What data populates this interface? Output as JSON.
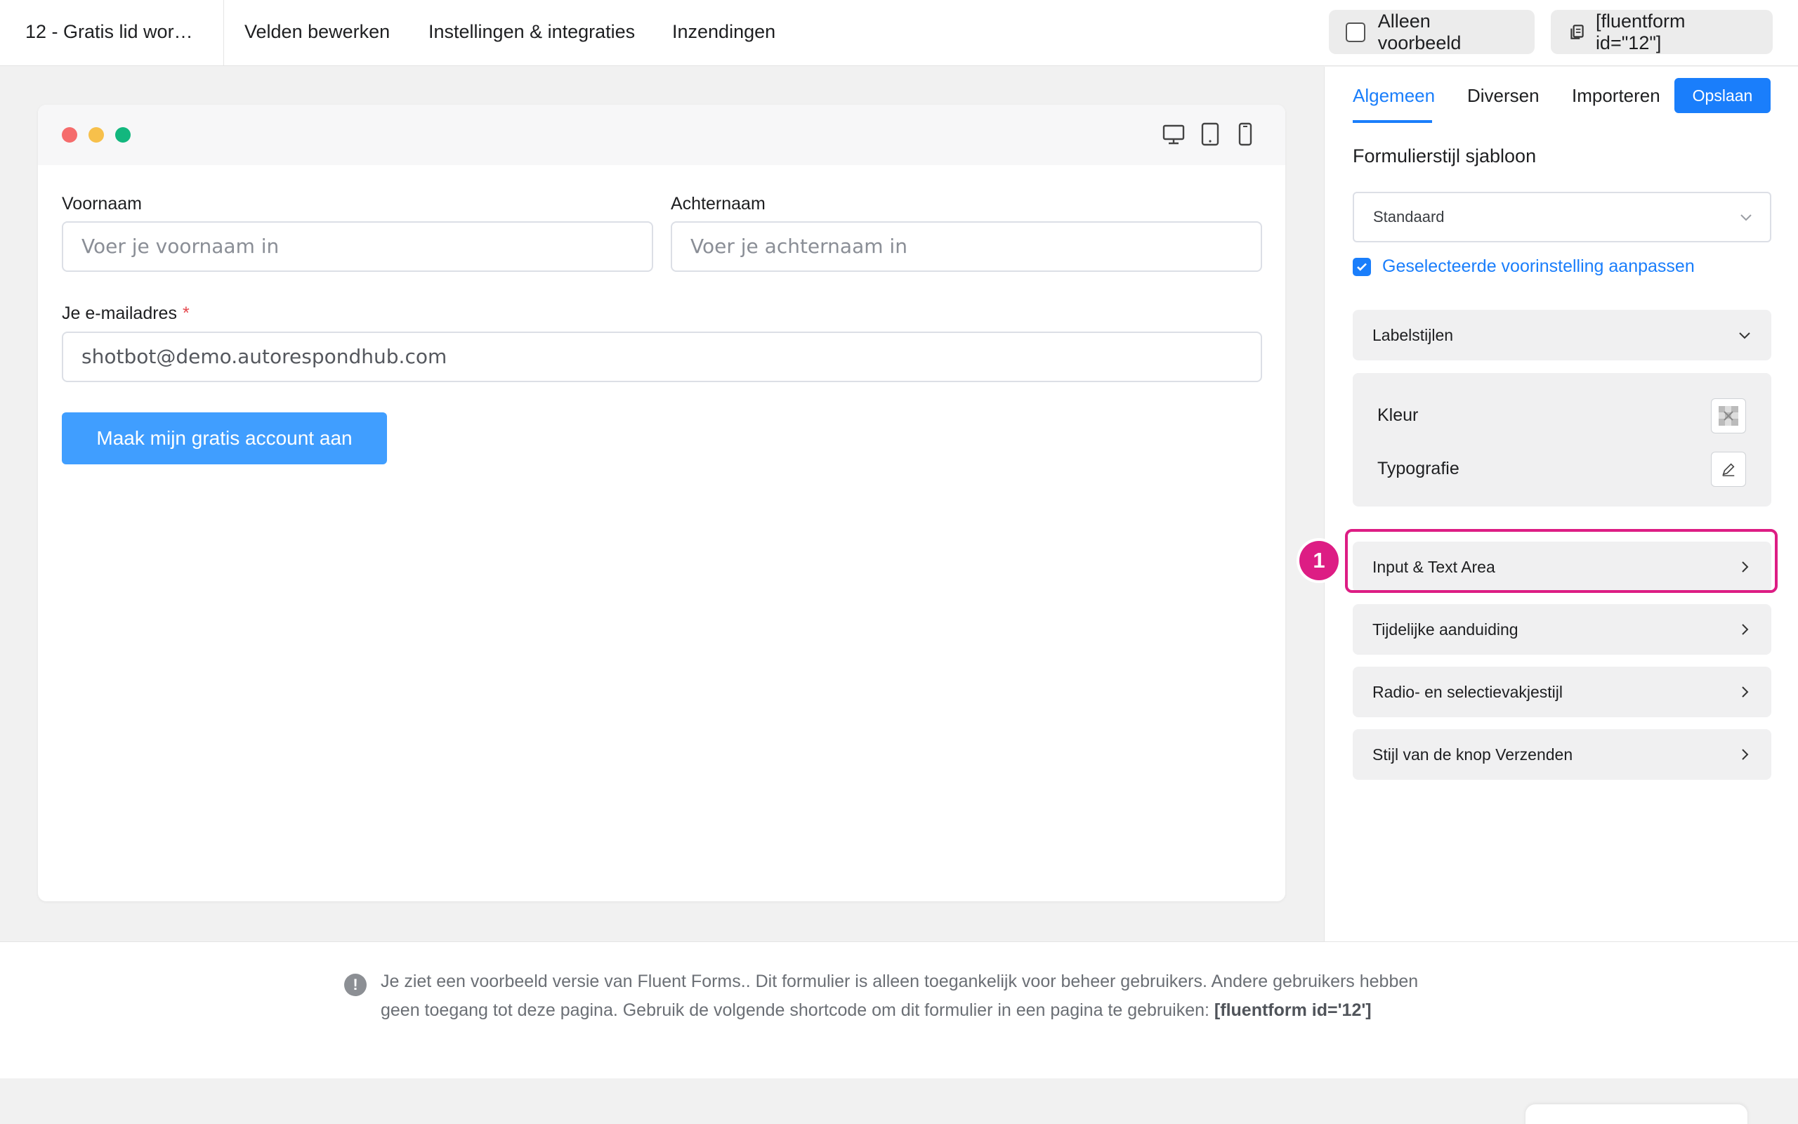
{
  "header": {
    "form_title": "12 - Gratis lid wor…",
    "nav": [
      "Velden bewerken",
      "Instellingen & integraties",
      "Inzendingen"
    ],
    "preview_only_label": "Alleen voorbeeld",
    "shortcode_label": "[fluentform id=\"12\"]"
  },
  "form": {
    "first_name_label": "Voornaam",
    "first_name_placeholder": "Voer je voornaam in",
    "last_name_label": "Achternaam",
    "last_name_placeholder": "Voer je achternaam in",
    "email_label": "Je e-mailadres",
    "email_required_mark": "*",
    "email_value": "shotbot@demo.autorespondhub.com",
    "submit_label": " Maak mijn gratis account aan"
  },
  "panel": {
    "tabs": [
      "Algemeen",
      "Diversen",
      "Importeren"
    ],
    "save_label": "Opslaan",
    "template_title": "Formulierstijl sjabloon",
    "template_value": "Standaard",
    "customize_label": "Geselecteerde voorinstelling aanpassen",
    "label_styles": "Labelstijlen",
    "color_label": "Kleur",
    "typography_label": "Typografie",
    "sections": [
      "Input & Text Area",
      "Tijdelijke aanduiding",
      "Radio- en selectievakjestijl",
      "Stijl van de knop Verzenden"
    ]
  },
  "annotation": {
    "marker": "1"
  },
  "notice": {
    "text": "Je ziet een voorbeeld versie van Fluent Forms.. Dit formulier is alleen toegankelijk voor beheer gebruikers. Andere gebruikers hebben geen toegang tot deze pagina. Gebruik de volgende shortcode om dit formulier in een pagina te gebruiken: ",
    "shortcode": "[fluentform id='12']"
  },
  "colors": {
    "accent": "#1a7efb",
    "submit": "#409eff",
    "highlight": "#dd1d84",
    "dot_red": "#f56c6c",
    "dot_yellow": "#f7c04b",
    "dot_green": "#13b77e"
  }
}
